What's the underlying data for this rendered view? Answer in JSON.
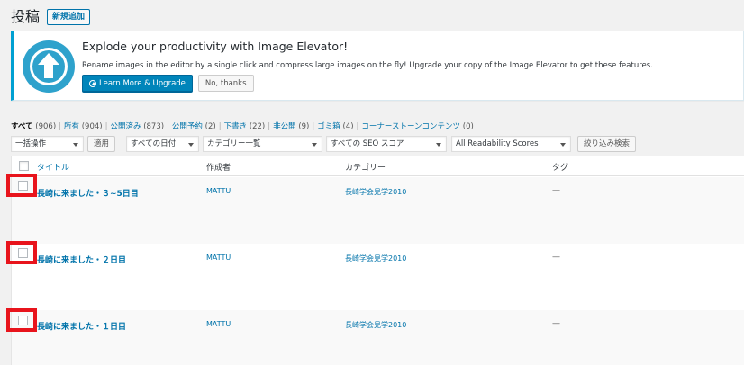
{
  "header": {
    "title": "投稿",
    "add_new_label": "新規追加"
  },
  "notice": {
    "title": "Explode your productivity with Image Elevator!",
    "text": "Rename images in the editor by a single click and compress large images on the fly! Upgrade your copy of the Image Elevator to get these features.",
    "primary_button": "Learn More & Upgrade",
    "secondary_button": "No, thanks",
    "icon": "upload-arrow-icon",
    "accent_color": "#00a0d2"
  },
  "filters": [
    {
      "label": "すべて",
      "count": "(906)",
      "current": true
    },
    {
      "label": "所有",
      "count": "(904)"
    },
    {
      "label": "公開済み",
      "count": "(873)"
    },
    {
      "label": "公開予約",
      "count": "(2)"
    },
    {
      "label": "下書き",
      "count": "(22)"
    },
    {
      "label": "非公開",
      "count": "(9)"
    },
    {
      "label": "ゴミ箱",
      "count": "(4)"
    },
    {
      "label": "コーナーストーンコンテンツ",
      "count": "(0)"
    }
  ],
  "tablenav": {
    "bulk_action": "一括操作",
    "apply": "適用",
    "dates": "すべての日付",
    "categories": "カテゴリー一覧",
    "seo": "すべての SEO スコア",
    "readability": "All Readability Scores",
    "filter": "絞り込み検索"
  },
  "table": {
    "columns": {
      "title": "タイトル",
      "author": "作成者",
      "categories": "カテゴリー",
      "tags": "タグ"
    },
    "rows": [
      {
        "title": "長崎に来ました・３~5日目",
        "author": "MATTU",
        "category": "長崎学会見学2010",
        "tags": "—"
      },
      {
        "title": "長崎に来ました・２日目",
        "author": "MATTU",
        "category": "長崎学会見学2010",
        "tags": "—"
      },
      {
        "title": "長崎に来ました・１日目",
        "author": "MATTU",
        "category": "長崎学会見学2010",
        "tags": "—"
      }
    ]
  },
  "colors": {
    "link": "#0073aa",
    "highlight": "#e8141c",
    "primary_button": "#0085ba"
  }
}
